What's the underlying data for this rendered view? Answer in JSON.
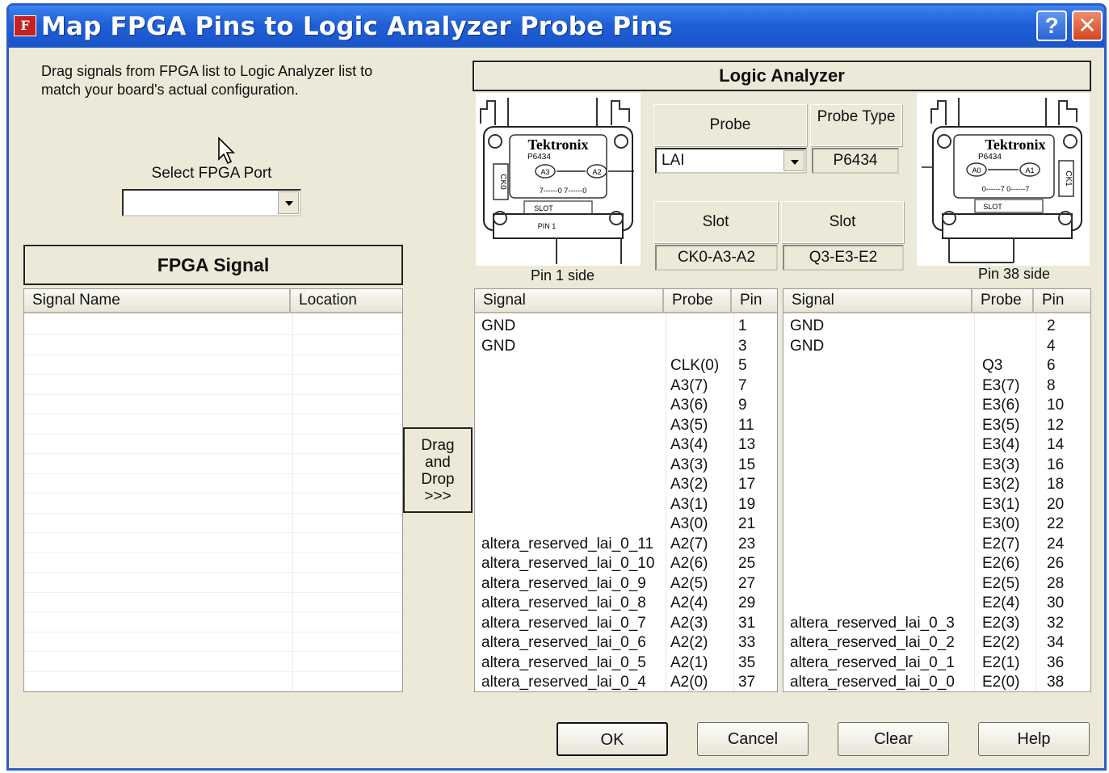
{
  "window": {
    "title": "Map FPGA Pins to Logic Analyzer Probe Pins",
    "app_icon": "F",
    "help_label": "?",
    "close_label": "✕"
  },
  "instructions": "Drag signals from FPGA list to Logic Analyzer list to match your board's actual configuration.",
  "fpga_port": {
    "label": "Select FPGA Port",
    "value": ""
  },
  "fpga_signal": {
    "title": "FPGA Signal",
    "columns": [
      "Signal Name",
      "Location"
    ]
  },
  "drag_drop": {
    "line1": "Drag",
    "line2": "and",
    "line3": "Drop",
    "line4": ">>>"
  },
  "logic_analyzer": {
    "title": "Logic Analyzer",
    "probe_label": "Probe",
    "probe_type_label": "Probe Type",
    "probe_value": "LAI",
    "probe_type_value": "P6434",
    "slot_label_left": "Slot",
    "slot_label_right": "Slot",
    "slot_value_left": "CK0-A3-A2",
    "slot_value_right": "Q3-E3-E2",
    "left_connector": {
      "brand": "Tektronix",
      "model": "P6434",
      "clk": "CK0",
      "a3": "A3",
      "a2": "A2",
      "range": "7------0  7------0",
      "slot": "SLOT",
      "pin": "PIN 1",
      "caption": "Pin 1 side"
    },
    "right_connector": {
      "brand": "Tektronix",
      "model": "P6434",
      "clk": "CK1",
      "a0": "A0",
      "a1": "A1",
      "range": "0------7  0------7",
      "slot": "SLOT",
      "caption": "Pin 38 side"
    }
  },
  "left_table": {
    "columns": [
      "Signal",
      "Probe",
      "Pin"
    ],
    "rows": [
      {
        "signal": "GND",
        "probe": "",
        "pin": "1"
      },
      {
        "signal": "GND",
        "probe": "",
        "pin": "3"
      },
      {
        "signal": "",
        "probe": "CLK(0)",
        "pin": "5"
      },
      {
        "signal": "",
        "probe": "A3(7)",
        "pin": "7"
      },
      {
        "signal": "",
        "probe": "A3(6)",
        "pin": "9"
      },
      {
        "signal": "",
        "probe": "A3(5)",
        "pin": "11"
      },
      {
        "signal": "",
        "probe": "A3(4)",
        "pin": "13"
      },
      {
        "signal": "",
        "probe": "A3(3)",
        "pin": "15"
      },
      {
        "signal": "",
        "probe": "A3(2)",
        "pin": "17"
      },
      {
        "signal": "",
        "probe": "A3(1)",
        "pin": "19"
      },
      {
        "signal": "",
        "probe": "A3(0)",
        "pin": "21"
      },
      {
        "signal": "altera_reserved_lai_0_11",
        "probe": "A2(7)",
        "pin": "23"
      },
      {
        "signal": "altera_reserved_lai_0_10",
        "probe": "A2(6)",
        "pin": "25"
      },
      {
        "signal": "altera_reserved_lai_0_9",
        "probe": "A2(5)",
        "pin": "27"
      },
      {
        "signal": "altera_reserved_lai_0_8",
        "probe": "A2(4)",
        "pin": "29"
      },
      {
        "signal": "altera_reserved_lai_0_7",
        "probe": "A2(3)",
        "pin": "31"
      },
      {
        "signal": "altera_reserved_lai_0_6",
        "probe": "A2(2)",
        "pin": "33"
      },
      {
        "signal": "altera_reserved_lai_0_5",
        "probe": "A2(1)",
        "pin": "35"
      },
      {
        "signal": "altera_reserved_lai_0_4",
        "probe": "A2(0)",
        "pin": "37"
      }
    ]
  },
  "right_table": {
    "columns": [
      "Signal",
      "Probe",
      "Pin"
    ],
    "rows": [
      {
        "signal": "GND",
        "probe": "",
        "pin": "2"
      },
      {
        "signal": "GND",
        "probe": "",
        "pin": "4"
      },
      {
        "signal": "",
        "probe": "Q3",
        "pin": "6"
      },
      {
        "signal": "",
        "probe": "E3(7)",
        "pin": "8"
      },
      {
        "signal": "",
        "probe": "E3(6)",
        "pin": "10"
      },
      {
        "signal": "",
        "probe": "E3(5)",
        "pin": "12"
      },
      {
        "signal": "",
        "probe": "E3(4)",
        "pin": "14"
      },
      {
        "signal": "",
        "probe": "E3(3)",
        "pin": "16"
      },
      {
        "signal": "",
        "probe": "E3(2)",
        "pin": "18"
      },
      {
        "signal": "",
        "probe": "E3(1)",
        "pin": "20"
      },
      {
        "signal": "",
        "probe": "E3(0)",
        "pin": "22"
      },
      {
        "signal": "",
        "probe": "E2(7)",
        "pin": "24"
      },
      {
        "signal": "",
        "probe": "E2(6)",
        "pin": "26"
      },
      {
        "signal": "",
        "probe": "E2(5)",
        "pin": "28"
      },
      {
        "signal": "",
        "probe": "E2(4)",
        "pin": "30"
      },
      {
        "signal": "altera_reserved_lai_0_3",
        "probe": "E2(3)",
        "pin": "32"
      },
      {
        "signal": "altera_reserved_lai_0_2",
        "probe": "E2(2)",
        "pin": "34"
      },
      {
        "signal": "altera_reserved_lai_0_1",
        "probe": "E2(1)",
        "pin": "36"
      },
      {
        "signal": "altera_reserved_lai_0_0",
        "probe": "E2(0)",
        "pin": "38"
      }
    ]
  },
  "buttons": {
    "ok": "OK",
    "cancel": "Cancel",
    "clear": "Clear",
    "help": "Help"
  }
}
